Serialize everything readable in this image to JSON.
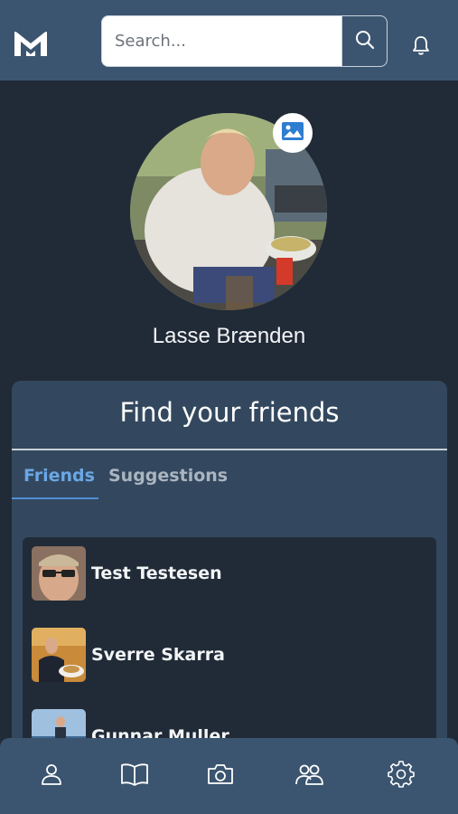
{
  "header": {
    "logo_text": "M",
    "search_placeholder": "Search...",
    "search_value": ""
  },
  "profile": {
    "name": "Lasse Brænden"
  },
  "friends_card": {
    "title": "Find your friends",
    "tabs": [
      {
        "label": "Friends",
        "active": true
      },
      {
        "label": "Suggestions",
        "active": false
      }
    ],
    "friends": [
      {
        "name": "Test Testesen"
      },
      {
        "name": "Sverre Skarra"
      },
      {
        "name": "Gunnar Muller"
      }
    ]
  },
  "bottom_nav": {
    "items": [
      {
        "icon": "person-icon"
      },
      {
        "icon": "book-icon"
      },
      {
        "icon": "camera-icon"
      },
      {
        "icon": "group-icon"
      },
      {
        "icon": "gear-icon"
      }
    ]
  },
  "colors": {
    "background": "#212b37",
    "header": "#3b5570",
    "card": "#33485e",
    "accent": "#6aa7e6"
  }
}
